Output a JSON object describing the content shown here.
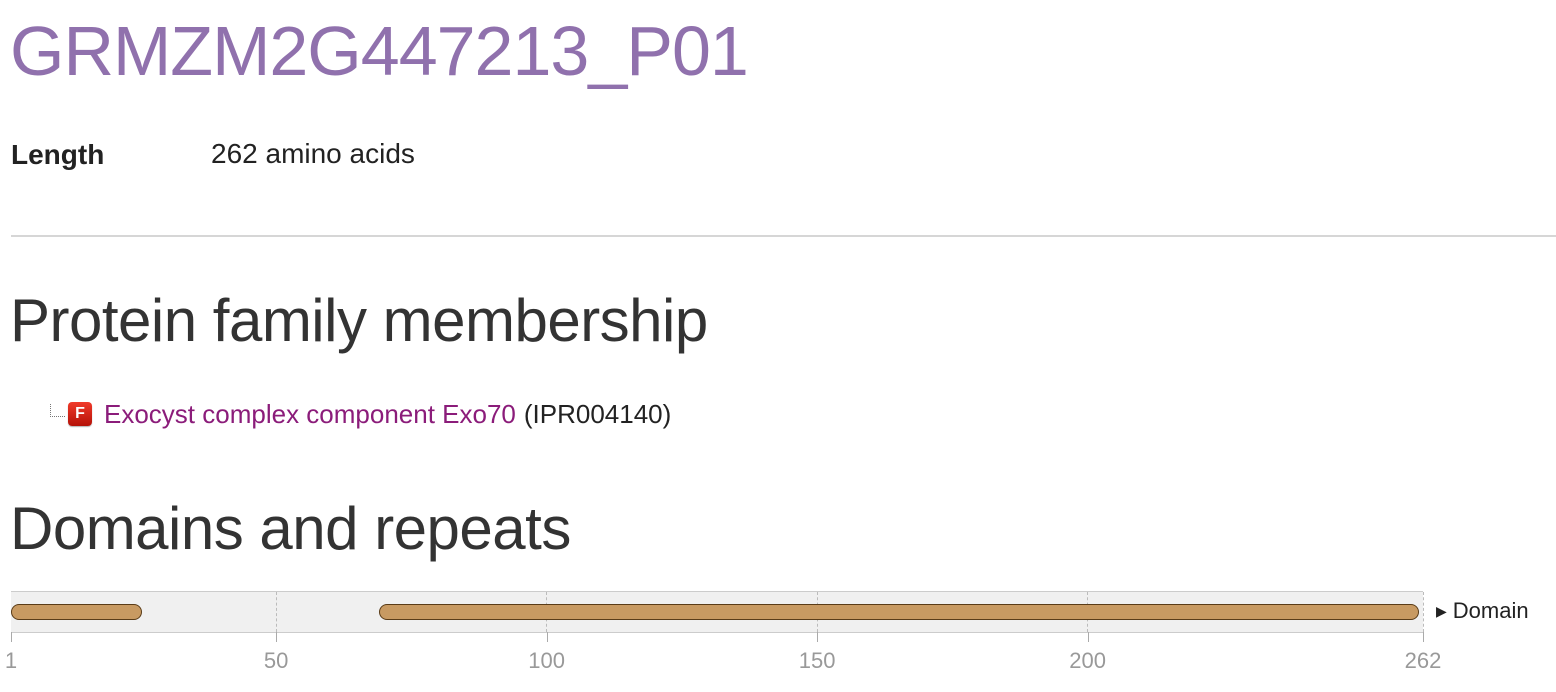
{
  "protein": {
    "title": "GRMZM2G447213_P01",
    "length_label": "Length",
    "length_value": "262 amino acids"
  },
  "family_section": {
    "title": "Protein family membership",
    "entries": [
      {
        "badge": "F",
        "name": "Exocyst complex component Exo70",
        "accession": "(IPR004140)"
      }
    ]
  },
  "domain_section": {
    "title": "Domains and repeats",
    "legend_label": "Domain",
    "colors": {
      "domain_fill": "#c89a62",
      "domain_border": "#5a3c18",
      "title_color": "#9071ad",
      "link_color": "#8b1c7a"
    }
  },
  "chart_data": {
    "type": "track",
    "x_range": [
      1,
      262
    ],
    "tick_labels": [
      "1",
      "50",
      "100",
      "150",
      "200",
      "262"
    ],
    "tick_values": [
      1,
      50,
      100,
      150,
      200,
      262
    ],
    "domains": [
      {
        "start": 1,
        "end": 26,
        "type": "Domain"
      },
      {
        "start": 69,
        "end": 262,
        "type": "Domain"
      }
    ]
  }
}
